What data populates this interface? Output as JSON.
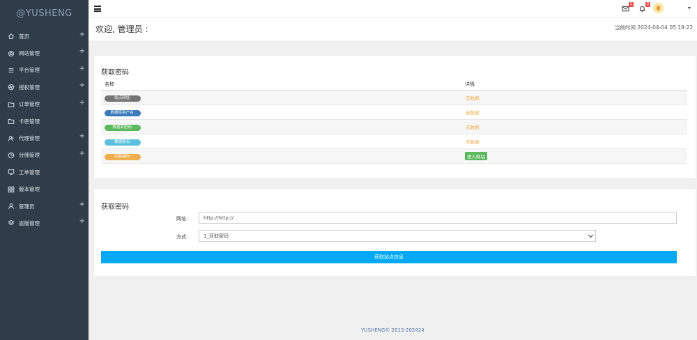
{
  "sidebar": {
    "brand": "@YUSHENG",
    "items": [
      {
        "label": "首页",
        "icon": "home-icon",
        "expandable": true
      },
      {
        "label": "网站管理",
        "icon": "gear-icon",
        "expandable": true
      },
      {
        "label": "平台管理",
        "icon": "list-icon",
        "expandable": true
      },
      {
        "label": "授权管理",
        "icon": "aperture-icon",
        "expandable": true
      },
      {
        "label": "订单管理",
        "icon": "folder-icon",
        "expandable": true
      },
      {
        "label": "卡密管理",
        "icon": "folder-icon",
        "expandable": false
      },
      {
        "label": "代理管理",
        "icon": "users-icon",
        "expandable": true
      },
      {
        "label": "分佣管理",
        "icon": "pie-icon",
        "expandable": true
      },
      {
        "label": "工单管理",
        "icon": "monitor-icon",
        "expandable": false
      },
      {
        "label": "版本管理",
        "icon": "grid-icon",
        "expandable": false
      },
      {
        "label": "管理员",
        "icon": "user-icon",
        "expandable": true
      },
      {
        "label": "盗版管理",
        "icon": "layers-icon",
        "expandable": true
      }
    ]
  },
  "topbar": {
    "mail_badge": "1",
    "bell_badge": "0"
  },
  "welcome": {
    "title": "欢迎, 管理员 :",
    "time_label": "当前时间",
    "time_value": "2024-04-04 05:19:22"
  },
  "panel1": {
    "title": "获取密码",
    "columns": [
      "名称",
      "详情"
    ],
    "rows": [
      {
        "name": "站点网址:",
        "color": "#757575",
        "detail": "无数据"
      },
      {
        "name": "数据库用户名:",
        "color": "#3a7ab8",
        "detail": "无数据"
      },
      {
        "name": "数据库密码:",
        "color": "#5cb85c",
        "detail": "无数据"
      },
      {
        "name": "数据库名:",
        "color": "#5bc0de",
        "detail": "无数据"
      },
      {
        "name": "功能操作:",
        "color": "#f0ad4e",
        "detail": "进入网站"
      }
    ]
  },
  "panel2": {
    "title": "获取密码",
    "url_label": "网址:",
    "url_value": "http://http://",
    "method_label": "方式:",
    "method_value": "1_获取密码",
    "submit_label": "获取站点信息"
  },
  "footer": {
    "text": "YUSHENG© 2013-202424"
  }
}
